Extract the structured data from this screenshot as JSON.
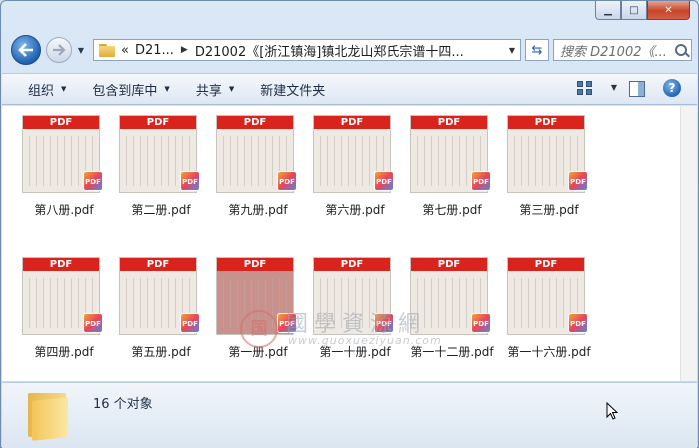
{
  "nav": {
    "crumbs": [
      "«",
      "D21...",
      "D21002《[浙江镇海]镇北龙山郑氏宗谱十四..."
    ],
    "search_placeholder": "搜索 D21002《..."
  },
  "toolbar": {
    "items": [
      "组织",
      "包含到库中",
      "共享",
      "新建文件夹"
    ]
  },
  "files": [
    {
      "name": "第八册.pdf",
      "label": "PDF",
      "badge": "PDF"
    },
    {
      "name": "第二册.pdf",
      "label": "PDF",
      "badge": "PDF"
    },
    {
      "name": "第九册.pdf",
      "label": "PDF",
      "badge": "PDF"
    },
    {
      "name": "第六册.pdf",
      "label": "PDF",
      "badge": "PDF"
    },
    {
      "name": "第七册.pdf",
      "label": "PDF",
      "badge": "PDF"
    },
    {
      "name": "第三册.pdf",
      "label": "PDF",
      "badge": "PDF"
    },
    {
      "name": "第四册.pdf",
      "label": "PDF",
      "badge": "PDF"
    },
    {
      "name": "第五册.pdf",
      "label": "PDF",
      "badge": "PDF"
    },
    {
      "name": "第一册.pdf",
      "label": "PDF",
      "badge": "PDF"
    },
    {
      "name": "第一十册.pdf",
      "label": "PDF",
      "badge": "PDF"
    },
    {
      "name": "第一十二册.pdf",
      "label": "PDF",
      "badge": "PDF"
    },
    {
      "name": "第一十六册.pdf",
      "label": "PDF",
      "badge": "PDF"
    }
  ],
  "watermark": {
    "seal": "国",
    "title": "國學資源網",
    "url": "www.guoxueziyuan.com"
  },
  "status": {
    "count": "16 个对象"
  },
  "colors": {
    "pdf_red": "#d9241e",
    "window_chrome": "#c5d8ee"
  }
}
